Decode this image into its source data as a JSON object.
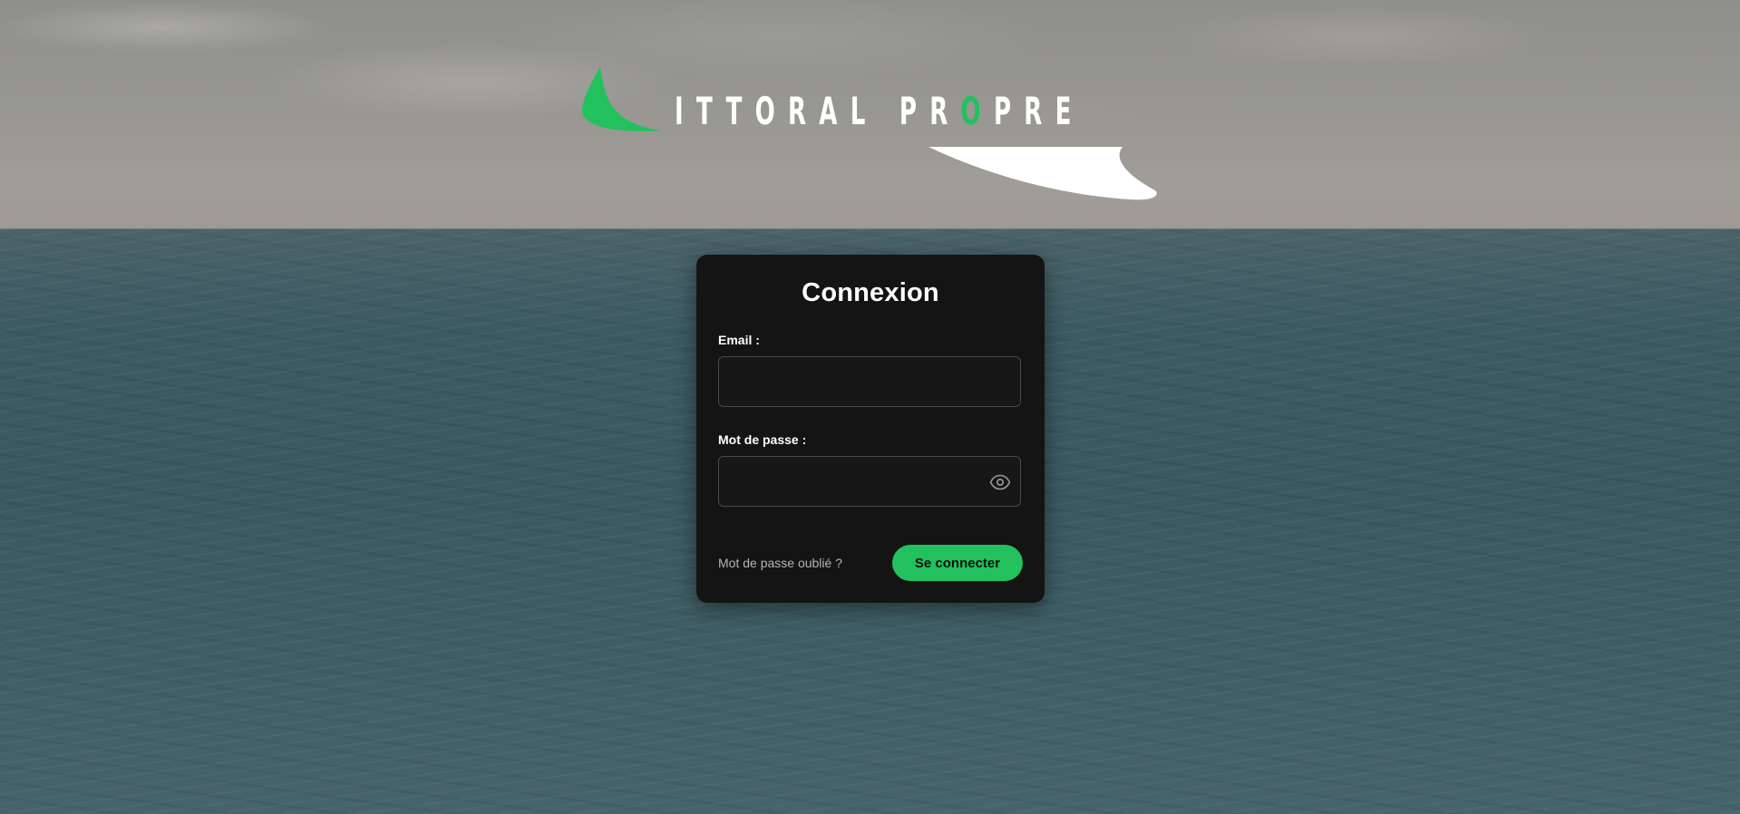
{
  "brand": {
    "logo_text_prefix": "ITTORAL PR",
    "logo_text_accent": "O",
    "logo_text_suffix": "PRE",
    "accent_color": "#22c15e",
    "mark_icon": "green-sail-icon",
    "swoosh_icon": "white-swoosh-icon"
  },
  "login": {
    "title": "Connexion",
    "email_label": "Email :",
    "email_value": "",
    "password_label": "Mot de passe :",
    "password_value": "",
    "toggle_visibility_icon": "eye-icon",
    "forgot_password": "Mot de passe oublié ?",
    "submit_label": "Se connecter"
  },
  "colors": {
    "card_background": "#141414",
    "button_background": "#22c15e",
    "button_text": "#111111"
  }
}
